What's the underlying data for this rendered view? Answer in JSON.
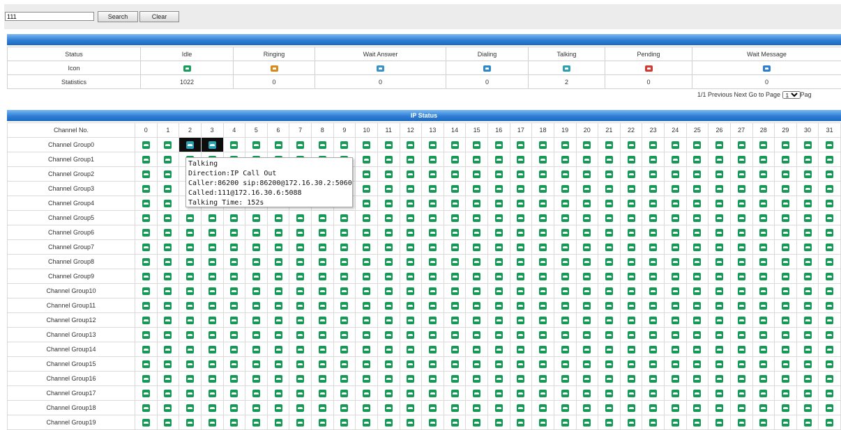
{
  "search": {
    "value": "111",
    "search_label": "Search",
    "clear_label": "Clear"
  },
  "summary": {
    "row_labels": {
      "status": "Status",
      "icon": "Icon",
      "statistics": "Statistics"
    },
    "columns": [
      {
        "status": "Idle",
        "icon": "idle-phone-icon",
        "count": "1022",
        "color": "#1a9c5a"
      },
      {
        "status": "Ringing",
        "icon": "ringing-phone-icon",
        "count": "0",
        "color": "#d88b1a"
      },
      {
        "status": "Wait Answer",
        "icon": "wait-answer-phone-icon",
        "count": "0",
        "color": "#3a93c8"
      },
      {
        "status": "Dialing",
        "icon": "dialing-phone-icon",
        "count": "0",
        "color": "#2e88c9"
      },
      {
        "status": "Talking",
        "icon": "talking-phone-icon",
        "count": "2",
        "color": "#2e9fb5"
      },
      {
        "status": "Pending",
        "icon": "pending-phone-icon",
        "count": "0",
        "color": "#d43a2f"
      },
      {
        "status": "Wait Message",
        "icon": "wait-message-phone-icon",
        "count": "0",
        "color": "#2f7fd0"
      }
    ]
  },
  "pager": {
    "text": "1/1 Previous Next Go to Page",
    "page_value": "1",
    "suffix": "Pag"
  },
  "ip_status": {
    "title": "IP Status",
    "channel_header": "Channel No.",
    "channels": [
      "0",
      "1",
      "2",
      "3",
      "4",
      "5",
      "6",
      "7",
      "8",
      "9",
      "10",
      "11",
      "12",
      "13",
      "14",
      "15",
      "16",
      "17",
      "18",
      "19",
      "20",
      "21",
      "22",
      "23",
      "24",
      "25",
      "26",
      "27",
      "28",
      "29",
      "30",
      "31"
    ],
    "groups": [
      "Channel Group0",
      "Channel Group1",
      "Channel Group2",
      "Channel Group3",
      "Channel Group4",
      "Channel Group5",
      "Channel Group6",
      "Channel Group7",
      "Channel Group8",
      "Channel Group9",
      "Channel Group10",
      "Channel Group11",
      "Channel Group12",
      "Channel Group13",
      "Channel Group14",
      "Channel Group15",
      "Channel Group16",
      "Channel Group17",
      "Channel Group18",
      "Channel Group19"
    ],
    "talking_cells": [
      {
        "group": 0,
        "channel": 2
      },
      {
        "group": 0,
        "channel": 3
      }
    ]
  },
  "tooltip": {
    "line1": "Talking",
    "line2": "Direction:IP Call Out",
    "line3": "Caller:86200 sip:86200@172.16.30.2:5060",
    "line4": "Called:111@172.16.30.6:5088",
    "line5": "Talking Time: 152s"
  }
}
